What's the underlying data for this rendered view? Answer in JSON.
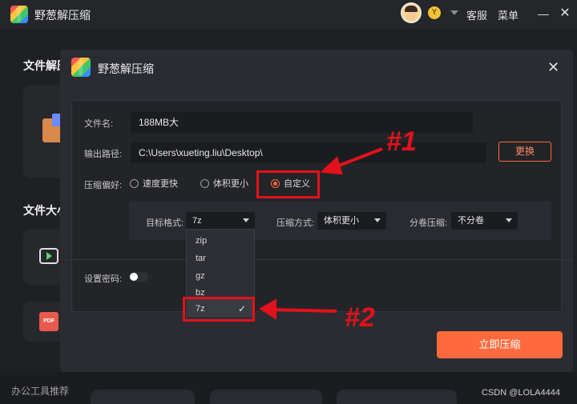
{
  "app": {
    "title": "野葱解压缩",
    "coin_badge": "Y",
    "service_label": "客服",
    "menu_label": "菜单",
    "minimize_glyph": "—",
    "close_glyph": "✕"
  },
  "background": {
    "section1_heading": "文件解压",
    "section2_heading": "文件大小",
    "footer_label": "办公工具推荐",
    "pdf_badge": "PDF"
  },
  "dialog": {
    "title": "野葱解压缩",
    "close_glyph": "✕",
    "file_name_label": "文件名:",
    "file_name_value": "188MB大",
    "output_path_label": "输出路径:",
    "output_path_value": "C:\\Users\\xueting.liu\\Desktop\\",
    "change_button": "更换",
    "compress_pref_label": "压缩偏好:",
    "radio_options": [
      {
        "label": "速度更快",
        "selected": false
      },
      {
        "label": "体积更小",
        "selected": false
      },
      {
        "label": "自定义",
        "selected": true
      }
    ],
    "target_format_label": "目标格式:",
    "target_format_value": "7z",
    "compress_mode_label": "压缩方式:",
    "compress_mode_value": "体积更小",
    "split_label": "分卷压缩:",
    "split_value": "不分卷",
    "password_label": "设置密码:",
    "password_enabled": false,
    "format_options": [
      "zip",
      "tar",
      "gz",
      "bz",
      "7z"
    ],
    "selected_format": "7z",
    "check_glyph": "✓",
    "submit_button": "立即压缩"
  },
  "annotations": {
    "label1": "#1",
    "label2": "#2",
    "color": "#e3111b"
  },
  "watermark": "CSDN @LOLA4444",
  "colors": {
    "accent": "#ff6a3d",
    "background": "#1f2024",
    "dialog": "#2b2c31"
  }
}
